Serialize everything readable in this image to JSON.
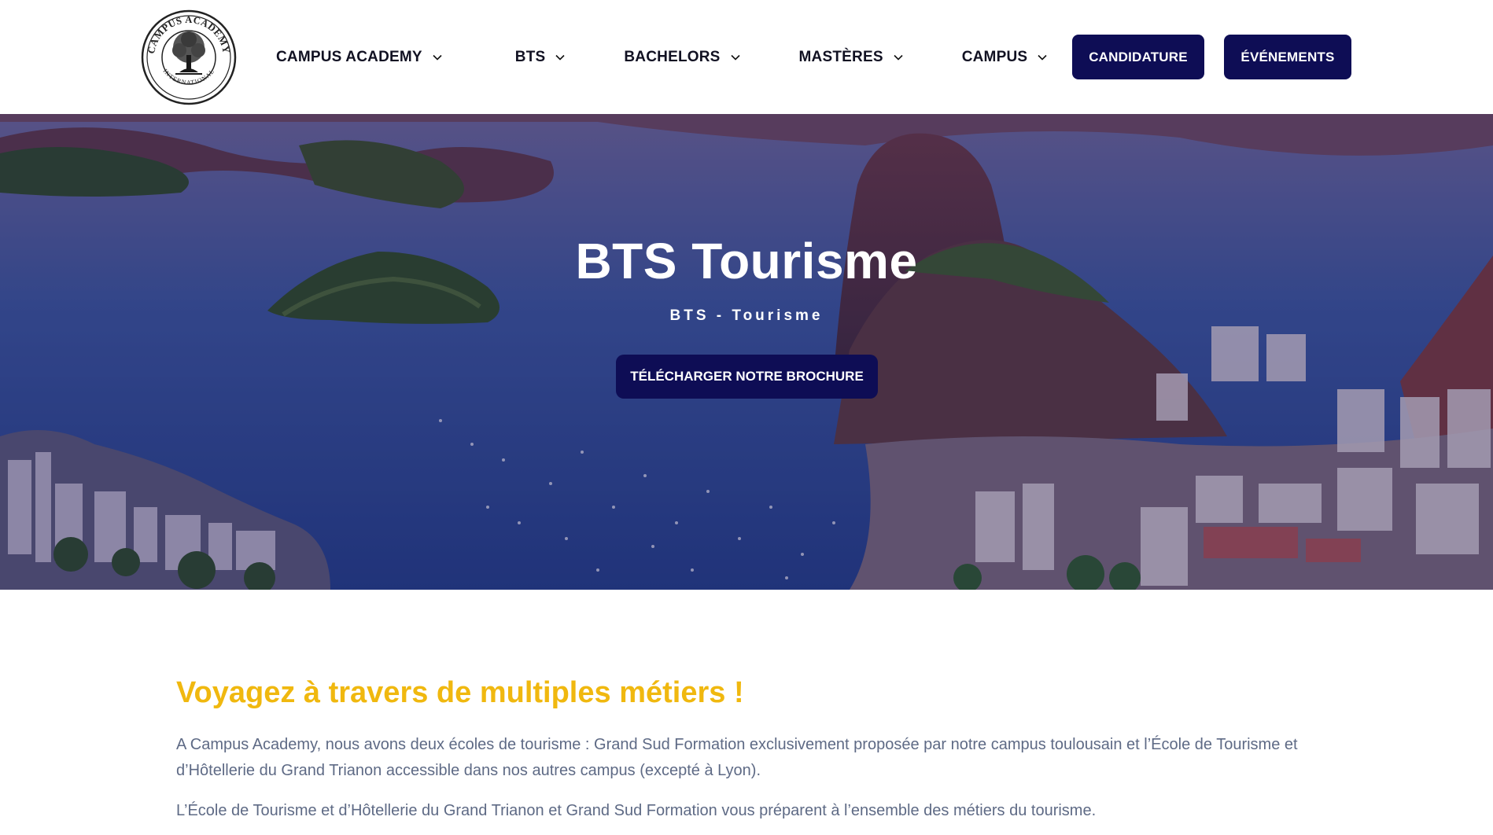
{
  "header": {
    "logo_text_top": "CAMPUS ACADEMY",
    "logo_text_bottom": "INTERNATIONAL",
    "nav": [
      {
        "label": "CAMPUS ACADEMY",
        "icon": "chevron-down-icon"
      },
      {
        "label": "BTS",
        "icon": "chevron-down-icon"
      },
      {
        "label": "BACHELORS",
        "icon": "chevron-down-icon"
      },
      {
        "label": "MASTÈRES",
        "icon": "chevron-down-icon"
      },
      {
        "label": "CAMPUS",
        "icon": "chevron-down-icon"
      }
    ],
    "candidature_label": "CANDIDATURE",
    "evenements_label": "ÉVÉNEMENTS"
  },
  "hero": {
    "title": "BTS Tourisme",
    "subtitle": "BTS - Tourisme",
    "brochure_label": "TÉLÉCHARGER NOTRE BROCHURE"
  },
  "main": {
    "heading": "Voyagez à travers de multiples métiers !",
    "paragraphs": [
      "A Campus Academy, nous avons deux écoles de tourisme : Grand Sud Formation exclusivement proposée par notre campus toulousain et l’École de Tourisme et d’Hôtellerie du Grand Trianon accessible dans nos autres campus (excepté à Lyon).",
      "L’École de Tourisme et d’Hôtellerie du Grand Trianon et Grand Sud Formation vous préparent à l’ensemble des métiers du tourisme."
    ]
  },
  "colors": {
    "brand_navy": "#0e0d55",
    "heading_yellow": "#f0b80f",
    "body_text": "#5e6a85"
  }
}
